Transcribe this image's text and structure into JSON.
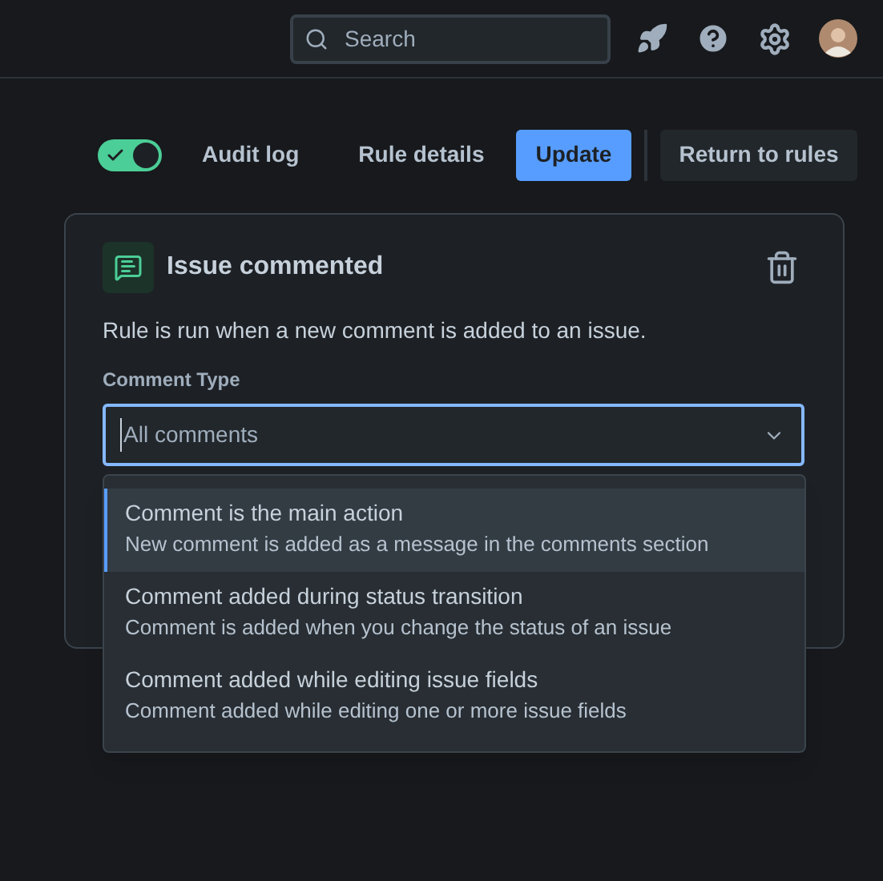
{
  "header": {
    "search": {
      "placeholder": "Search"
    }
  },
  "toolbar": {
    "toggle": {
      "on": true
    },
    "links": [
      "Audit log",
      "Rule details"
    ],
    "primary_button": "Update",
    "secondary_button": "Return to rules"
  },
  "card": {
    "title": "Issue commented",
    "description": "Rule is run when a new comment is added to an issue.",
    "field_label": "Comment Type",
    "field_value": "All comments",
    "options": [
      {
        "title": "Comment is the main action",
        "description": "New comment is added as a message in the comments section",
        "selected": true
      },
      {
        "title": "Comment added during status transition",
        "description": "Comment is added when you change the status of an issue",
        "selected": false
      },
      {
        "title": "Comment added while editing issue fields",
        "description": "Comment added while editing one or more issue fields",
        "selected": false
      }
    ]
  }
}
